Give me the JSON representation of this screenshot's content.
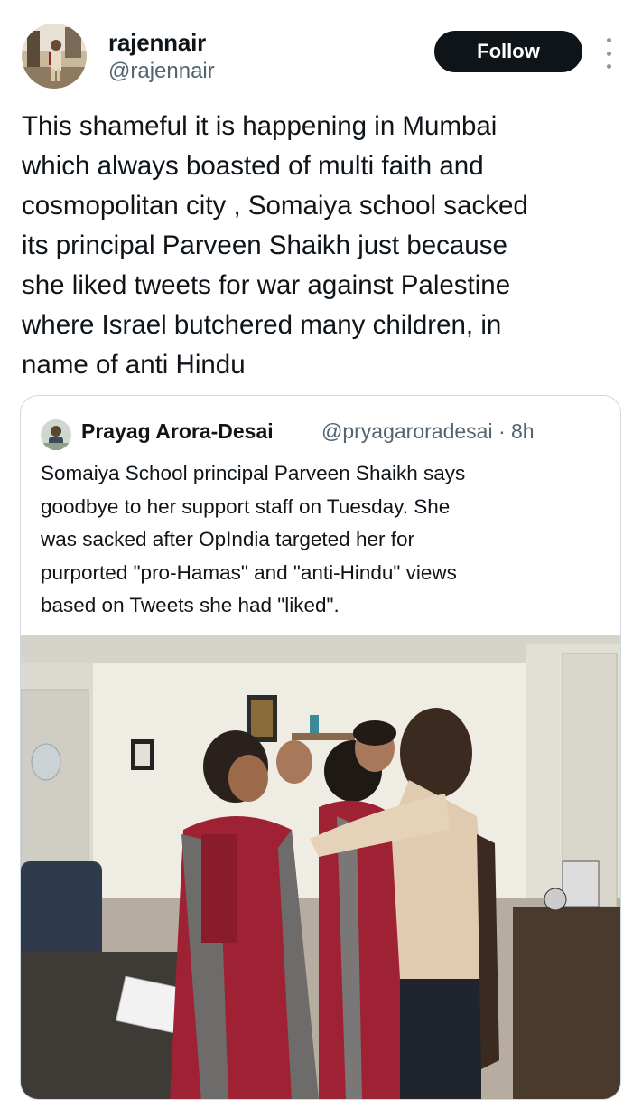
{
  "tweet": {
    "author": {
      "display_name": "rajennair",
      "handle": "@rajennair"
    },
    "follow_label": "Follow",
    "more_icon": "more-options-icon",
    "text_lines": [
      "This shameful it is happening in Mumbai",
      "which always boasted of multi faith and",
      "cosmopolitan city , Somaiya school sacked",
      "its principal Parveen Shaikh just because",
      "she liked tweets for war against Palestine",
      "where Israel butchered many children, in",
      "name of anti Hindu"
    ]
  },
  "quote": {
    "author": {
      "display_name": "Prayag Arora-Desai",
      "handle_time": "@pryagaroradesai · 8h"
    },
    "text_lines": [
      "Somaiya School principal Parveen Shaikh says",
      "goodbye to her support staff on Tuesday. She",
      "was sacked after OpIndia targeted her for",
      "purported \"pro-Hamas\" and \"anti-Hindu\" views",
      "based on Tweets she had \"liked\"."
    ],
    "media": "photo-of-women-hugging-in-office"
  }
}
